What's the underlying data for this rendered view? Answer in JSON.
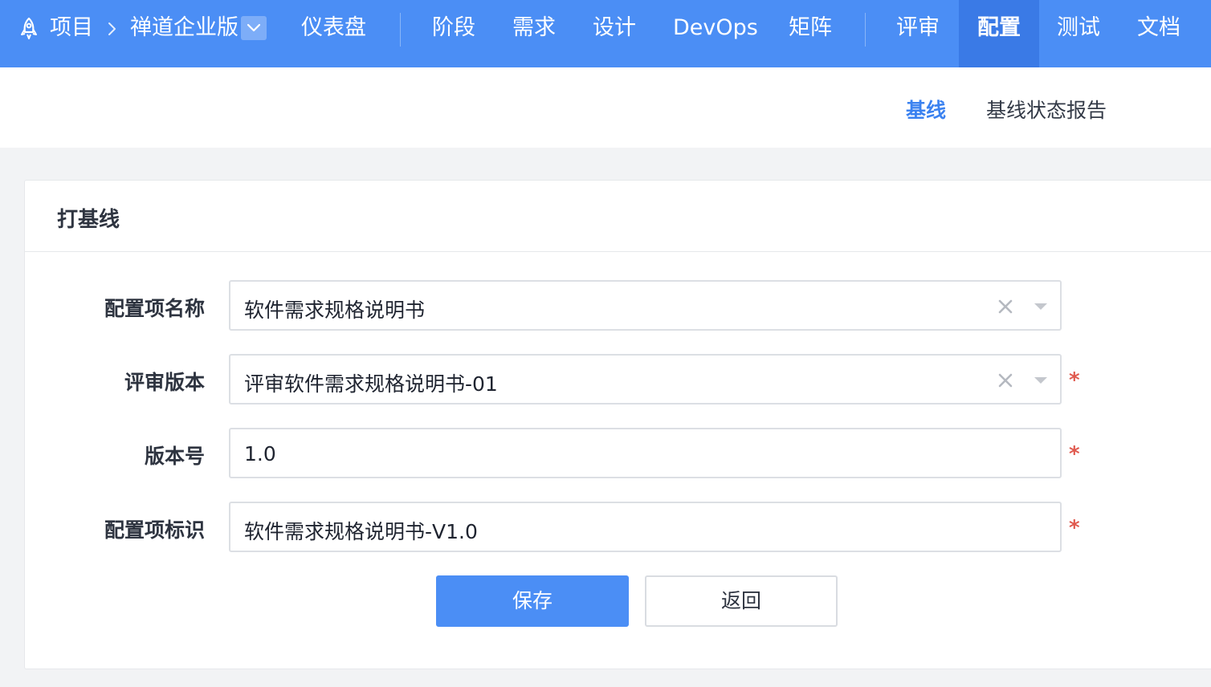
{
  "header": {
    "breadcrumb_root": "项目",
    "product_name": "禅道企业版",
    "nav": {
      "dashboard": "仪表盘",
      "stage": "阶段",
      "story": "需求",
      "design": "设计",
      "devops": "DevOps",
      "matrix": "矩阵",
      "review": "评审",
      "config": "配置",
      "test": "测试",
      "doc": "文档"
    },
    "active_nav": "配置",
    "colors": {
      "bar": "#4b8ef5",
      "active": "#3a7ae6"
    },
    "icons": {
      "logo": "rocket-icon",
      "separator": "chevron-right-icon",
      "product_switch": "chevron-down-icon"
    }
  },
  "subnav": {
    "baseline": "基线",
    "baseline_report": "基线状态报告",
    "active": "基线"
  },
  "panel": {
    "title": "打基线"
  },
  "form": {
    "config_item_name": {
      "label": "配置项名称",
      "value": "软件需求规格说明书",
      "required": false
    },
    "review_version": {
      "label": "评审版本",
      "value": "评审软件需求规格说明书-01",
      "required": true
    },
    "version_number": {
      "label": "版本号",
      "value": "1.0",
      "required": true
    },
    "config_item_id": {
      "label": "配置项标识",
      "value": "软件需求规格说明书-V1.0",
      "required": true
    },
    "required_mark": "*"
  },
  "actions": {
    "save": "保存",
    "back": "返回"
  }
}
